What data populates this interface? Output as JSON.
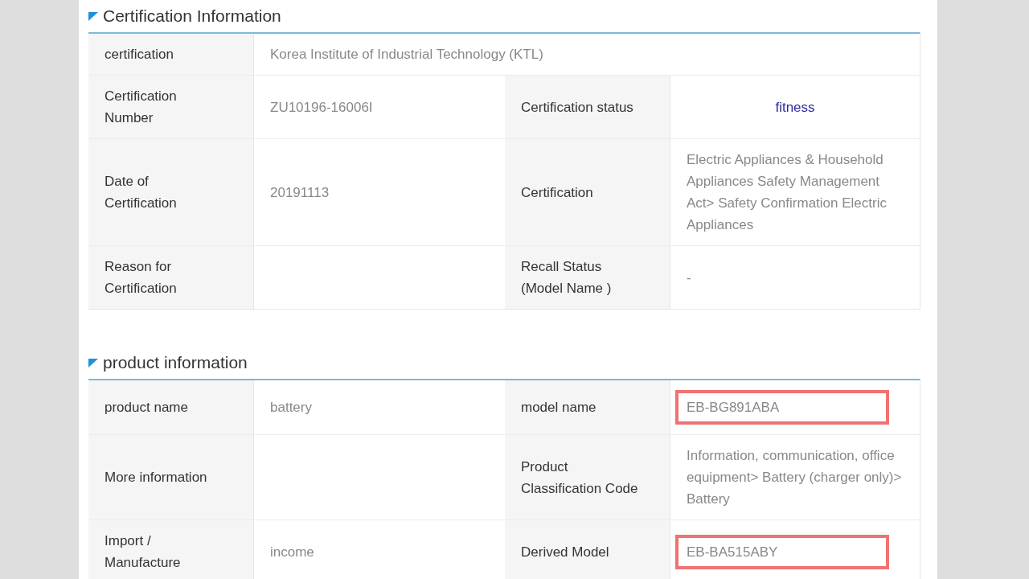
{
  "sections": [
    {
      "title": "Certification Information",
      "rows": [
        {
          "fields": [
            {
              "label": "certification",
              "value": "Korea Institute of Industrial Technology (KTL)",
              "kind": "plain"
            }
          ]
        },
        {
          "fields": [
            {
              "label": "Certification Number",
              "value": "ZU10196-16006I",
              "kind": "plain"
            },
            {
              "label": "Certification status",
              "value": "fitness",
              "kind": "status"
            }
          ]
        },
        {
          "fields": [
            {
              "label": "Date of Certification",
              "value": "20191113",
              "kind": "plain"
            },
            {
              "label": "Certification",
              "value": "Electric Appliances & Household Appliances Safety Management Act> Safety Confirmation Electric Appliances",
              "kind": "plain"
            }
          ]
        },
        {
          "fields": [
            {
              "label": "Reason for Certification",
              "kind": "plain"
            },
            {
              "label": "Recall Status (Model Name )",
              "value": "-",
              "kind": "plain"
            }
          ]
        }
      ]
    },
    {
      "title": "product information",
      "rows": [
        {
          "fields": [
            {
              "label": "product name",
              "value": "battery",
              "kind": "plain"
            },
            {
              "label": "model name",
              "value": "EB-BG891ABA",
              "kind": "plain",
              "highlighted": true
            }
          ]
        },
        {
          "fields": [
            {
              "label": "More information",
              "kind": "plain"
            },
            {
              "label": "Product Classification Code",
              "value": "Information, communication, office equipment> Battery (charger only)> Battery",
              "kind": "plain"
            }
          ]
        },
        {
          "fields": [
            {
              "label": "Import / Manufacture",
              "value": "income",
              "kind": "plain"
            },
            {
              "label": "Derived Model",
              "value": "EB-BA515ABY",
              "kind": "plain",
              "highlighted": true
            }
          ]
        }
      ]
    }
  ]
}
